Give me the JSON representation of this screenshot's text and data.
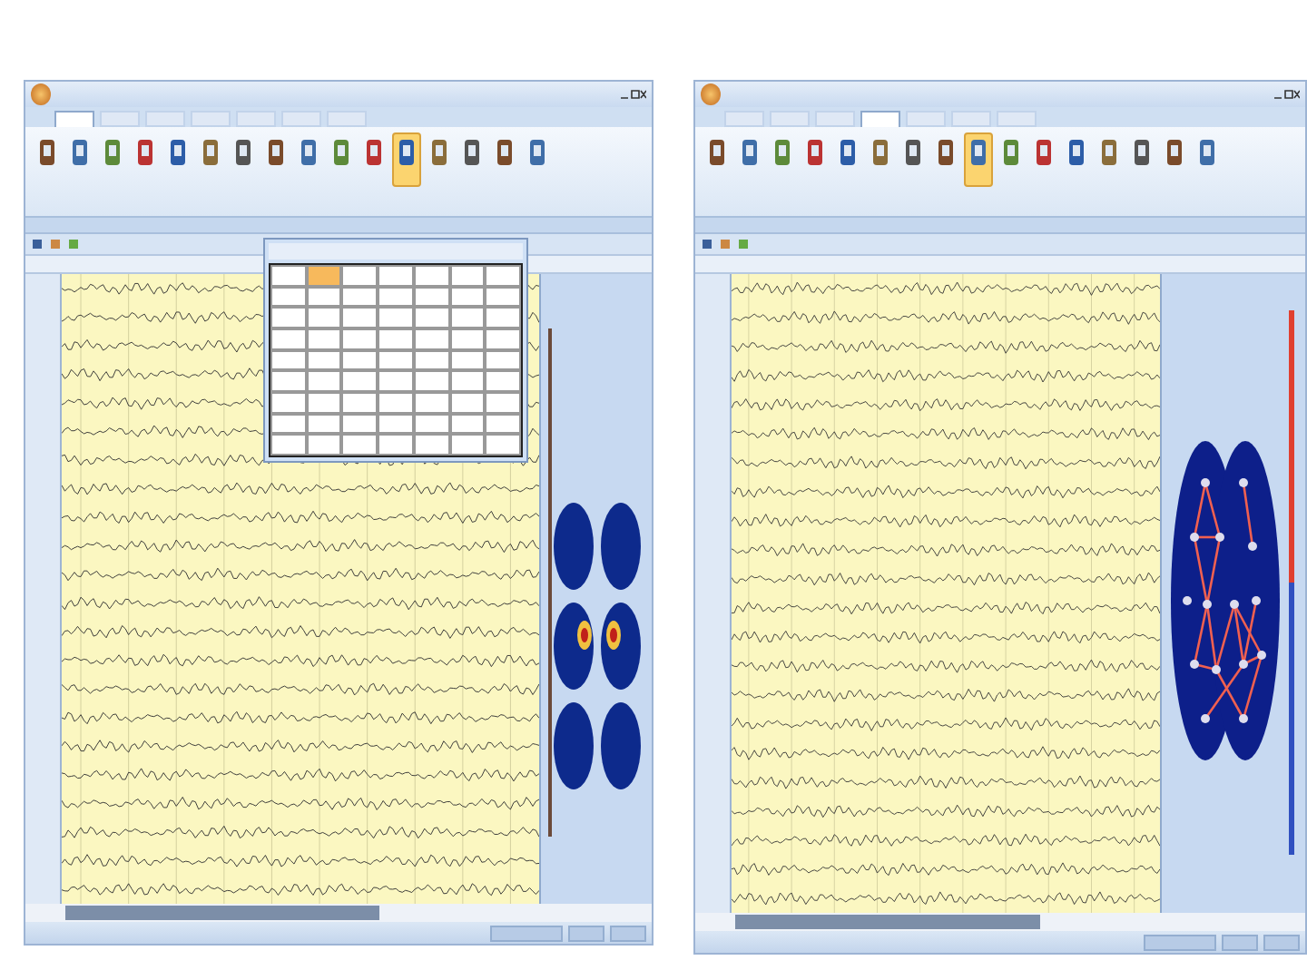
{
  "windows": [
    {
      "ribbon_tabs": [
        {
          "selected": true
        },
        {
          "selected": false
        },
        {
          "selected": false
        },
        {
          "selected": false
        },
        {
          "selected": false
        },
        {
          "selected": false
        },
        {
          "selected": false
        }
      ],
      "ribbon_buttons": [
        {
          "selected": false
        },
        {
          "selected": false
        },
        {
          "selected": false
        },
        {
          "selected": false
        },
        {
          "selected": false
        },
        {
          "selected": false
        },
        {
          "selected": false
        },
        {
          "selected": false
        },
        {
          "selected": false
        },
        {
          "selected": false
        },
        {
          "selected": false
        },
        {
          "selected": true
        },
        {
          "selected": false
        },
        {
          "selected": false
        },
        {
          "selected": false
        },
        {
          "selected": false
        }
      ],
      "channels": [
        {
          "kind": "eeg"
        },
        {
          "kind": "eeg"
        },
        {
          "kind": "eeg"
        },
        {
          "kind": "eeg"
        },
        {
          "kind": "eeg"
        },
        {
          "kind": "eeg"
        },
        {
          "kind": "eeg"
        },
        {
          "kind": "eeg"
        },
        {
          "kind": "eeg"
        },
        {
          "kind": "eeg"
        },
        {
          "kind": "eeg"
        },
        {
          "kind": "eeg"
        },
        {
          "kind": "eeg"
        },
        {
          "kind": "eeg"
        },
        {
          "kind": "eeg"
        },
        {
          "kind": "eeg"
        },
        {
          "kind": "eeg"
        },
        {
          "kind": "eeg"
        },
        {
          "kind": "eeg"
        },
        {
          "kind": "eeg"
        },
        {
          "kind": "eeg"
        },
        {
          "kind": "eeg"
        }
      ],
      "side_panel": {
        "kind": "topo-maps"
      },
      "dialog": {
        "rows": [
          {
            "selected": true
          },
          {
            "selected": false
          },
          {
            "selected": false
          },
          {
            "selected": false
          },
          {
            "selected": false
          },
          {
            "selected": false
          },
          {
            "selected": false
          },
          {
            "selected": false
          },
          {
            "selected": false
          }
        ]
      }
    },
    {
      "ribbon_tabs": [
        {
          "selected": false
        },
        {
          "selected": false
        },
        {
          "selected": false
        },
        {
          "selected": true
        },
        {
          "selected": false
        },
        {
          "selected": false
        },
        {
          "selected": false
        }
      ],
      "ribbon_buttons": [
        {
          "selected": false
        },
        {
          "selected": false
        },
        {
          "selected": false
        },
        {
          "selected": false
        },
        {
          "selected": false
        },
        {
          "selected": false
        },
        {
          "selected": false
        },
        {
          "selected": false
        },
        {
          "selected": true
        },
        {
          "selected": false
        },
        {
          "selected": false
        },
        {
          "selected": false
        },
        {
          "selected": false
        },
        {
          "selected": false
        },
        {
          "selected": false
        },
        {
          "selected": false
        }
      ],
      "channels": [
        {
          "kind": "eeg"
        },
        {
          "kind": "eeg"
        },
        {
          "kind": "eeg"
        },
        {
          "kind": "eeg"
        },
        {
          "kind": "eeg"
        },
        {
          "kind": "eeg"
        },
        {
          "kind": "eeg"
        },
        {
          "kind": "eeg"
        },
        {
          "kind": "eeg"
        },
        {
          "kind": "eeg"
        },
        {
          "kind": "eeg"
        },
        {
          "kind": "eeg"
        },
        {
          "kind": "eeg"
        },
        {
          "kind": "eeg"
        },
        {
          "kind": "eeg"
        },
        {
          "kind": "eeg"
        },
        {
          "kind": "eeg"
        },
        {
          "kind": "eeg"
        },
        {
          "kind": "eeg"
        },
        {
          "kind": "eeg"
        },
        {
          "kind": "eeg"
        },
        {
          "kind": "eeg"
        }
      ],
      "side_panel": {
        "kind": "connectivity"
      }
    }
  ]
}
